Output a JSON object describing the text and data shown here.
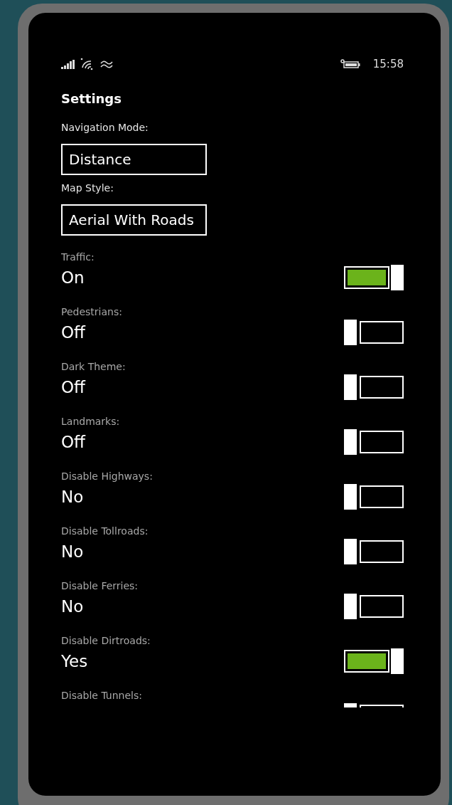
{
  "status_bar": {
    "time": "15:58"
  },
  "title": "Settings",
  "pickers": [
    {
      "label": "Navigation Mode:",
      "value": "Distance"
    },
    {
      "label": "Map Style:",
      "value": "Aerial With Roads"
    }
  ],
  "toggles": [
    {
      "label": "Traffic:",
      "value": "On",
      "on": true
    },
    {
      "label": "Pedestrians:",
      "value": "Off",
      "on": false
    },
    {
      "label": "Dark Theme:",
      "value": "Off",
      "on": false
    },
    {
      "label": "Landmarks:",
      "value": "Off",
      "on": false
    },
    {
      "label": "Disable Highways:",
      "value": "No",
      "on": false
    },
    {
      "label": "Disable Tollroads:",
      "value": "No",
      "on": false
    },
    {
      "label": "Disable Ferries:",
      "value": "No",
      "on": false
    },
    {
      "label": "Disable Dirtroads:",
      "value": "Yes",
      "on": true
    },
    {
      "label": "Disable Tunnels:",
      "on": false
    }
  ]
}
